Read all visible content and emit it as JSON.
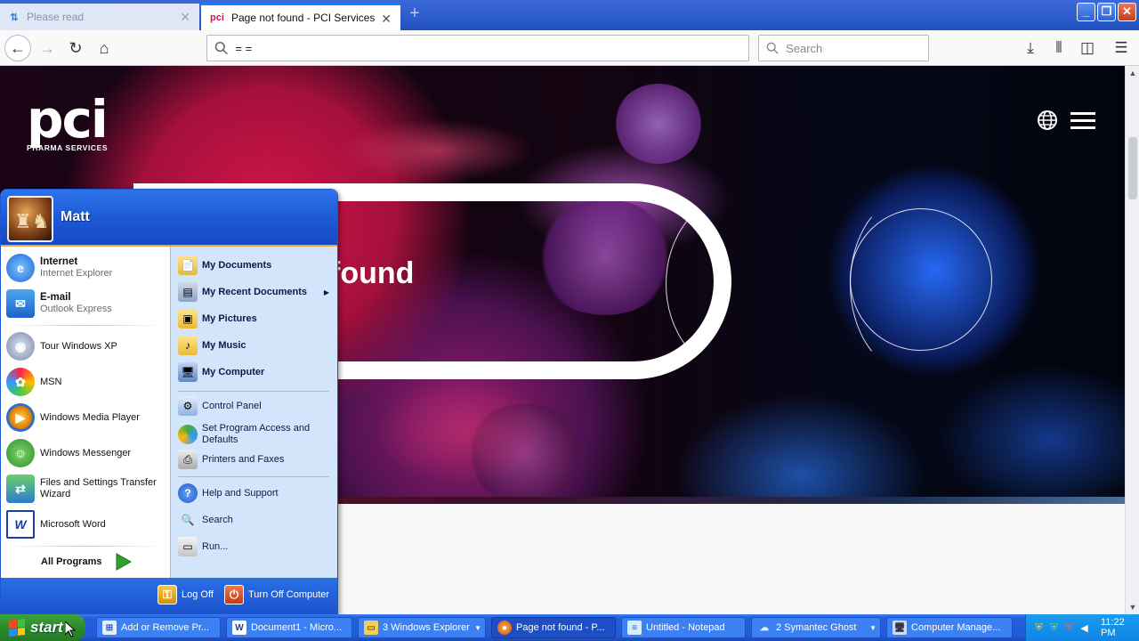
{
  "browser": {
    "tabs": [
      {
        "label": "Please read",
        "icon": "tab-favicon-blue"
      },
      {
        "label": "Page not found - PCI Services",
        "icon": "pci-favicon",
        "favicon_text": "pci"
      }
    ],
    "url": "= =",
    "search_placeholder": "Search"
  },
  "page": {
    "logo_mark": "pci",
    "logo_sub": "PHARMA SERVICES",
    "title": "Page not found",
    "title_visible": "e not found"
  },
  "start_menu": {
    "user": "Matt",
    "pinned": [
      {
        "label": "Internet",
        "sub": "Internet Explorer",
        "icon": "internet-explorer-icon"
      },
      {
        "label": "E-mail",
        "sub": "Outlook Express",
        "icon": "outlook-express-icon"
      }
    ],
    "recent": [
      {
        "label": "Tour Windows XP",
        "icon": "tour-xp-icon"
      },
      {
        "label": "MSN",
        "icon": "msn-icon"
      },
      {
        "label": "Windows Media Player",
        "icon": "media-player-icon"
      },
      {
        "label": "Windows Messenger",
        "icon": "messenger-icon"
      },
      {
        "label": "Files and Settings Transfer Wizard",
        "icon": "transfer-wizard-icon"
      },
      {
        "label": "Microsoft Word",
        "icon": "word-icon"
      }
    ],
    "all_programs": "All Programs",
    "places": [
      {
        "label": "My Documents",
        "icon": "folder-icon"
      },
      {
        "label": "My Recent Documents",
        "icon": "recent-docs-icon"
      },
      {
        "label": "My Pictures",
        "icon": "pictures-folder-icon"
      },
      {
        "label": "My Music",
        "icon": "music-folder-icon"
      },
      {
        "label": "My Computer",
        "icon": "computer-icon"
      }
    ],
    "system": [
      {
        "label": "Control Panel",
        "icon": "control-panel-icon"
      },
      {
        "label": "Set Program Access and Defaults",
        "icon": "program-access-icon"
      },
      {
        "label": "Printers and Faxes",
        "icon": "printer-icon"
      }
    ],
    "help": [
      {
        "label": "Help and Support",
        "icon": "help-icon"
      },
      {
        "label": "Search",
        "icon": "search-icon"
      },
      {
        "label": "Run...",
        "icon": "run-icon"
      }
    ],
    "log_off": "Log Off",
    "turn_off": "Turn Off Computer"
  },
  "taskbar": {
    "start": "start",
    "tasks": [
      {
        "label": "Add or Remove Pr...",
        "icon": "add-remove-icon"
      },
      {
        "label": "Document1 - Micro...",
        "icon": "word-icon"
      },
      {
        "label": "3 Windows Explorer",
        "icon": "explorer-folder-icon"
      },
      {
        "label": "Page not found - P...",
        "icon": "firefox-icon"
      },
      {
        "label": "Untitled - Notepad",
        "icon": "notepad-icon"
      },
      {
        "label": "2 Symantec Ghost",
        "icon": "ghost-icon"
      },
      {
        "label": "Computer Manage...",
        "icon": "computer-management-icon"
      }
    ],
    "clock": "11:22 PM"
  },
  "colors": {
    "xp_blue": "#245ddb",
    "start_green": "#2c8a2c",
    "hero_red": "#d4154a",
    "hero_blue": "#286eff"
  }
}
